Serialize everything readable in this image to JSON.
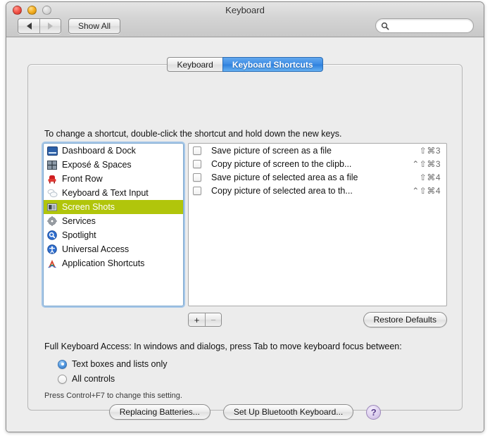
{
  "window": {
    "title": "Keyboard",
    "traffic_lights": [
      "close",
      "minimize",
      "zoom"
    ]
  },
  "toolbar": {
    "back_label": "◀",
    "forward_label": "▶",
    "show_all_label": "Show All",
    "search_value": "",
    "search_placeholder": ""
  },
  "tabs": [
    {
      "label": "Keyboard",
      "active": false
    },
    {
      "label": "Keyboard Shortcuts",
      "active": true
    }
  ],
  "main": {
    "hint": "To change a shortcut, double-click the shortcut and hold down the new keys.",
    "categories": [
      {
        "label": "Dashboard & Dock",
        "icon": "dashboard-icon",
        "selected": false
      },
      {
        "label": "Exposé & Spaces",
        "icon": "expose-grid-icon",
        "selected": false
      },
      {
        "label": "Front Row",
        "icon": "front-row-chair-icon",
        "selected": false
      },
      {
        "label": "Keyboard & Text Input",
        "icon": "speech-bubbles-icon",
        "selected": false
      },
      {
        "label": "Screen Shots",
        "icon": "camera-icon",
        "selected": true
      },
      {
        "label": "Services",
        "icon": "gear-icon",
        "selected": false
      },
      {
        "label": "Spotlight",
        "icon": "spotlight-magnifier-icon",
        "selected": false
      },
      {
        "label": "Universal Access",
        "icon": "accessibility-icon",
        "selected": false
      },
      {
        "label": "Application Shortcuts",
        "icon": "application-a-icon",
        "selected": false
      }
    ],
    "shortcuts": [
      {
        "checked": false,
        "name": "Save picture of screen as a file",
        "keys": "⇧⌘3"
      },
      {
        "checked": false,
        "name": "Copy picture of screen to the clipb...",
        "keys": "⌃⇧⌘3"
      },
      {
        "checked": false,
        "name": "Save picture of selected area as a file",
        "keys": "⇧⌘4"
      },
      {
        "checked": false,
        "name": "Copy picture of selected area to th...",
        "keys": "⌃⇧⌘4"
      }
    ],
    "add_label": "+",
    "remove_label": "−",
    "restore_defaults_label": "Restore Defaults"
  },
  "full_keyboard_access": {
    "title": "Full Keyboard Access: In windows and dialogs, press Tab to move keyboard focus between:",
    "options": [
      {
        "label": "Text boxes and lists only",
        "selected": true
      },
      {
        "label": "All controls",
        "selected": false
      }
    ],
    "note": "Press Control+F7 to change this setting."
  },
  "footer": {
    "replacing_batteries_label": "Replacing Batteries...",
    "bluetooth_label": "Set Up Bluetooth Keyboard...",
    "help_label": "?"
  },
  "colors": {
    "selection_olive": "#b1c50b",
    "tab_active_blue": "#3d8ce4",
    "focus_ring": "#7fa9cf",
    "window_bg": "#ededed"
  }
}
